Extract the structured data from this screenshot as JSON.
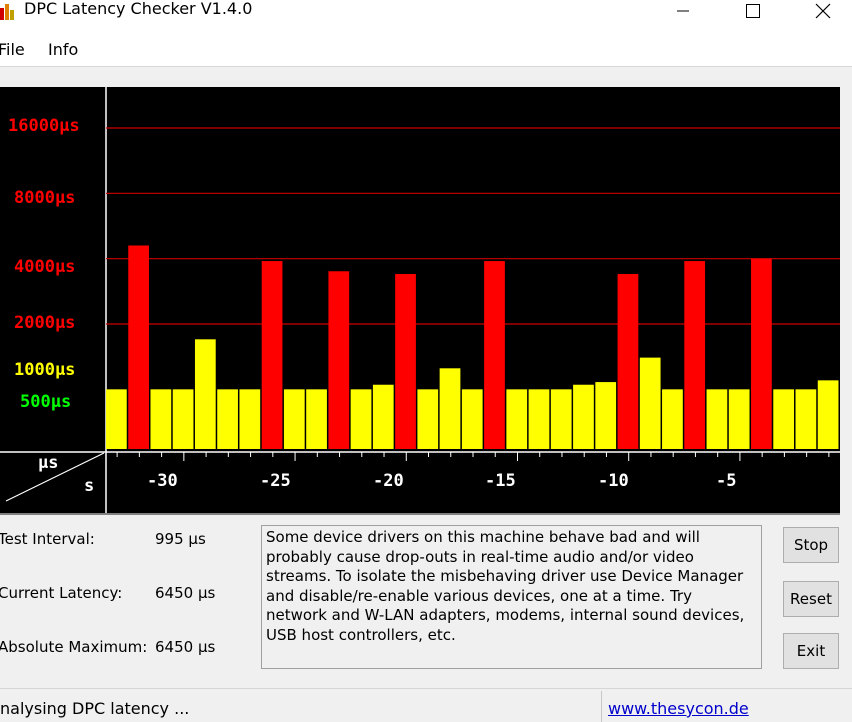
{
  "window": {
    "title": "DPC Latency Checker V1.4.0",
    "controls": [
      "minimize",
      "maximize",
      "close"
    ]
  },
  "menu": {
    "items": [
      "File",
      "Info"
    ]
  },
  "chart": {
    "y_tick_labels": [
      {
        "label": "16000µs",
        "color": "#ff0000",
        "gridline": true
      },
      {
        "label": "8000µs",
        "color": "#ff0000",
        "gridline": true
      },
      {
        "label": "4000µs",
        "color": "#ff0000",
        "gridline": true
      },
      {
        "label": "2000µs",
        "color": "#ff0000",
        "gridline": true
      },
      {
        "label": "1000µs",
        "color": "#ffff00",
        "gridline": false
      },
      {
        "label": "500µs",
        "color": "#00ff00",
        "gridline": false
      }
    ],
    "corner": {
      "y_unit": "µs",
      "x_unit": "s"
    },
    "x_tick_labels": [
      "-30",
      "-25",
      "-20",
      "-15",
      "-10",
      "-5"
    ],
    "colors": {
      "background": "#000000",
      "red": "#ff0000",
      "yellow": "#ffff00",
      "green": "#00ff00",
      "grid": "#cc0000"
    }
  },
  "chart_data": {
    "type": "bar",
    "title": "",
    "xlabel": "s",
    "ylabel": "µs",
    "x_range_s": [
      -33,
      0
    ],
    "y_scale": "log",
    "series": [
      {
        "values": [
          1000,
          4600,
          1000,
          1000,
          1700,
          1000,
          1000,
          3900,
          1000,
          1000,
          3500,
          1000,
          1050,
          3400,
          1000,
          1250,
          1000,
          3900,
          1000,
          1000,
          1000,
          1050,
          1080,
          3400,
          1400,
          1000,
          3900,
          1000,
          1000,
          4000,
          1000,
          1000,
          1100
        ],
        "colors": [
          "yellow",
          "red",
          "yellow",
          "yellow",
          "yellow",
          "yellow",
          "yellow",
          "red",
          "yellow",
          "yellow",
          "red",
          "yellow",
          "yellow",
          "red",
          "yellow",
          "yellow",
          "yellow",
          "red",
          "yellow",
          "yellow",
          "yellow",
          "yellow",
          "yellow",
          "red",
          "yellow",
          "yellow",
          "red",
          "yellow",
          "yellow",
          "red",
          "yellow",
          "yellow",
          "yellow"
        ]
      }
    ]
  },
  "stats": {
    "test_interval_label": "Test Interval:",
    "test_interval_value": "995 µs",
    "current_latency_label": "Current Latency:",
    "current_latency_value": "6450 µs",
    "absolute_max_label": "Absolute Maximum:",
    "absolute_max_value": "6450 µs"
  },
  "message": "Some device drivers on this machine behave bad and will probably cause drop-outs in real-time audio and/or video streams. To isolate the misbehaving driver use Device Manager and disable/re-enable various devices, one at a time. Try network and W-LAN adapters, modems, internal sound devices, USB host controllers, etc.",
  "buttons": {
    "stop": "Stop",
    "reset": "Reset",
    "exit": "Exit"
  },
  "status": {
    "text": "nalysing DPC latency ...",
    "link": "www.thesycon.de"
  }
}
